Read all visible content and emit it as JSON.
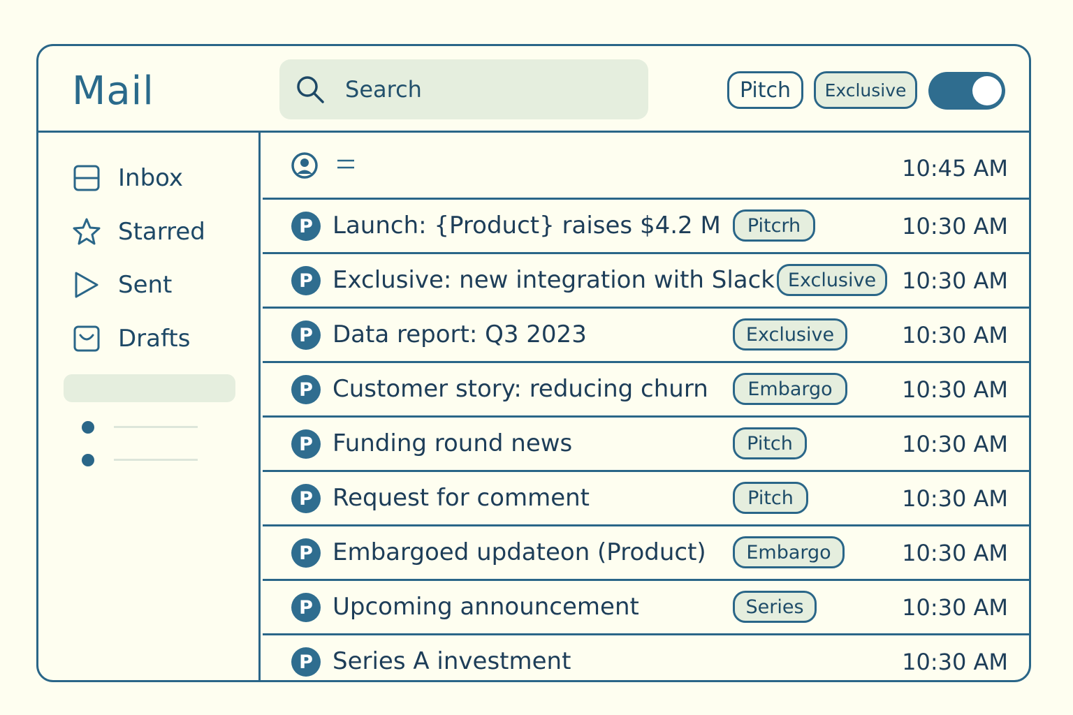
{
  "app": {
    "title": "Mail"
  },
  "search": {
    "placeholder": "Search"
  },
  "header_filters": [
    {
      "label": "Pitch"
    },
    {
      "label": "Exclusive"
    }
  ],
  "toggle": {
    "state": "on"
  },
  "sidebar": {
    "items": [
      {
        "label": "Inbox",
        "icon": "inbox-icon"
      },
      {
        "label": "Starred",
        "icon": "star-icon"
      },
      {
        "label": "Sent",
        "icon": "send-icon"
      },
      {
        "label": "Drafts",
        "icon": "drafts-icon"
      }
    ]
  },
  "messages": {
    "header_row": {
      "time": "10:45 AM"
    },
    "rows": [
      {
        "avatar": "P",
        "subject": "Launch: {Product} raises $4.2 M",
        "tag": "Pitcrh",
        "time": "10:30 AM"
      },
      {
        "avatar": "P",
        "subject": "Exclusive: new integration with Slack",
        "tag": "Exclusive",
        "time": "10:30 AM"
      },
      {
        "avatar": "P",
        "subject": "Data report: Q3 2023",
        "tag": "Exclusive",
        "time": "10:30 AM"
      },
      {
        "avatar": "P",
        "subject": "Customer story: reducing churn",
        "tag": "Embargo",
        "time": "10:30 AM"
      },
      {
        "avatar": "P",
        "subject": "Funding round news",
        "tag": "Pitch",
        "time": "10:30 AM"
      },
      {
        "avatar": "P",
        "subject": "Request for comment",
        "tag": "Pitch",
        "time": "10:30 AM"
      },
      {
        "avatar": "P",
        "subject": "Embargoed updateon (Product)",
        "tag": "Embargo",
        "time": "10:30 AM"
      },
      {
        "avatar": "P",
        "subject": "Upcoming announcement",
        "tag": "Series",
        "time": "10:30 AM"
      },
      {
        "avatar": "P",
        "subject": "Series A investment",
        "tag": "",
        "time": "10:30 AM"
      }
    ]
  },
  "colors": {
    "accent": "#2a6688",
    "background": "#fefef0",
    "chip_fill": "#e5eede"
  }
}
